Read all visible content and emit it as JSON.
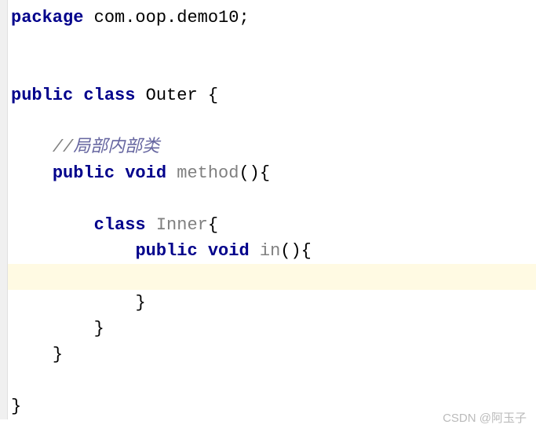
{
  "code": {
    "line1": {
      "kw_package": "package",
      "pkg_name": " com.oop.demo10;"
    },
    "line4": {
      "kw_public": "public ",
      "kw_class": "class",
      "class_name": " Outer ",
      "brace": "{"
    },
    "line6": {
      "indent": "    ",
      "comment_slash": "//",
      "comment_text": "局部内部类"
    },
    "line7": {
      "indent": "    ",
      "kw_public": "public ",
      "kw_void": "void",
      "method_name": " method",
      "parens_brace": "(){"
    },
    "line9": {
      "indent": "        ",
      "kw_class": "class",
      "class_name": " Inner",
      "brace": "{"
    },
    "line10": {
      "indent": "            ",
      "kw_public": "public ",
      "kw_void": "void",
      "method_name": " in",
      "parens_brace": "(){"
    },
    "line12": {
      "indent": "            ",
      "brace": "}"
    },
    "line13": {
      "indent": "        ",
      "brace": "}"
    },
    "line14": {
      "indent": "    ",
      "brace": "}"
    },
    "line16": {
      "brace": "}"
    }
  },
  "watermark": "CSDN @阿玉子"
}
